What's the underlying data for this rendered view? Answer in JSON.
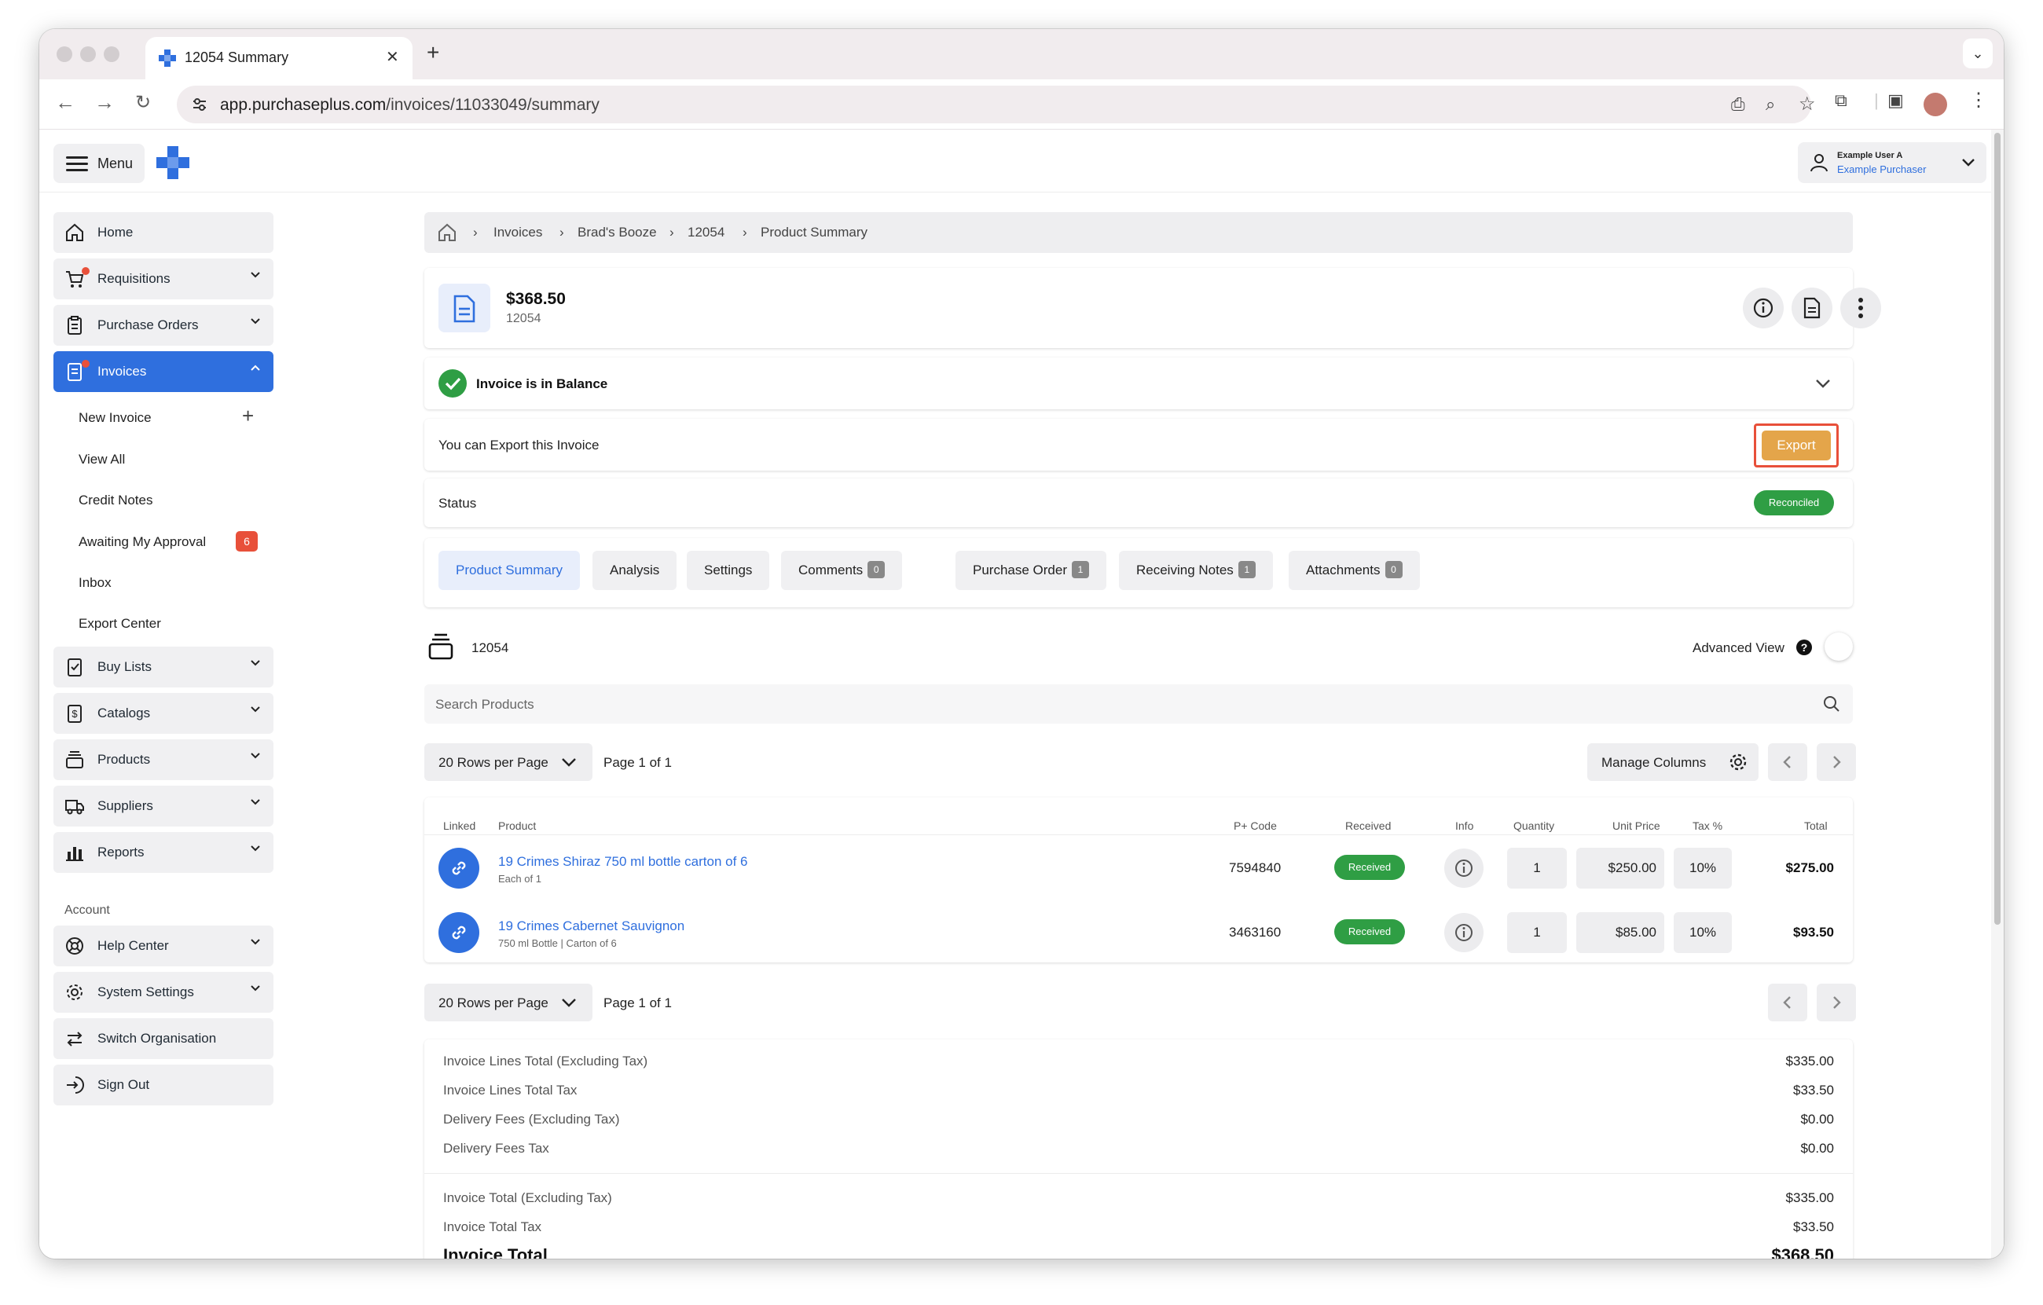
{
  "browser": {
    "tab_title": "12054 Summary",
    "url_domain": "app.purchaseplus.com",
    "url_path": "/invoices/11033049/summary"
  },
  "header": {
    "menu_label": "Menu",
    "user_name": "Example User A",
    "user_role": "Example Purchaser"
  },
  "sidebar": {
    "home": "Home",
    "requisitions": "Requisitions",
    "purchase_orders": "Purchase Orders",
    "invoices": "Invoices",
    "new_invoice": "New Invoice",
    "view_all": "View All",
    "credit_notes": "Credit Notes",
    "awaiting_my_approval": "Awaiting My Approval",
    "awaiting_count": "6",
    "inbox": "Inbox",
    "export_center": "Export Center",
    "buy_lists": "Buy Lists",
    "catalogs": "Catalogs",
    "products": "Products",
    "suppliers": "Suppliers",
    "reports": "Reports",
    "account_label": "Account",
    "help_center": "Help Center",
    "system_settings": "System Settings",
    "switch_organisation": "Switch Organisation",
    "sign_out": "Sign Out"
  },
  "breadcrumb": {
    "invoices": "Invoices",
    "supplier": "Brad's Booze",
    "invoice": "12054",
    "current": "Product Summary"
  },
  "invoice": {
    "amount": "$368.50",
    "number": "12054",
    "balance_text": "Invoice is in Balance",
    "export_text": "You can Export this Invoice",
    "export_button": "Export",
    "status_label": "Status",
    "status_value": "Reconciled"
  },
  "tabs": {
    "product_summary": "Product Summary",
    "analysis": "Analysis",
    "settings": "Settings",
    "comments": "Comments",
    "comments_count": "0",
    "purchase_order": "Purchase Order",
    "purchase_order_count": "1",
    "receiving_notes": "Receiving Notes",
    "receiving_notes_count": "1",
    "attachments": "Attachments",
    "attachments_count": "0"
  },
  "products_section": {
    "title": "12054",
    "advanced_view": "Advanced View",
    "search_placeholder": "Search Products",
    "rows_per_page": "20 Rows per Page",
    "page_info": "Page 1 of 1",
    "manage_columns": "Manage Columns"
  },
  "table": {
    "headers": {
      "linked": "Linked",
      "product": "Product",
      "code": "P+ Code",
      "received": "Received",
      "info": "Info",
      "quantity": "Quantity",
      "unit_price": "Unit Price",
      "tax": "Tax %",
      "total": "Total"
    },
    "rows": [
      {
        "name": "19 Crimes Shiraz 750 ml bottle carton of 6",
        "sub": "Each of 1",
        "code": "7594840",
        "received": "Received",
        "quantity": "1",
        "unit_price": "$250.00",
        "tax": "10%",
        "total": "$275.00"
      },
      {
        "name": "19 Crimes Cabernet Sauvignon",
        "sub": "750 ml Bottle | Carton of 6",
        "code": "3463160",
        "received": "Received",
        "quantity": "1",
        "unit_price": "$85.00",
        "tax": "10%",
        "total": "$93.50"
      }
    ]
  },
  "summary": {
    "lines_total_ex_label": "Invoice Lines Total (Excluding Tax)",
    "lines_total_ex": "$335.00",
    "lines_tax_label": "Invoice Lines Total Tax",
    "lines_tax": "$33.50",
    "delivery_ex_label": "Delivery Fees (Excluding Tax)",
    "delivery_ex": "$0.00",
    "delivery_tax_label": "Delivery Fees Tax",
    "delivery_tax": "$0.00",
    "invoice_total_ex_label": "Invoice Total (Excluding Tax)",
    "invoice_total_ex": "$335.00",
    "invoice_total_tax_label": "Invoice Total Tax",
    "invoice_total_tax": "$33.50",
    "invoice_total_label": "Invoice Total",
    "invoice_total": "$368.50"
  },
  "colors": {
    "accent": "#2f6fde",
    "export_button": "#e4a54a",
    "export_highlight": "#e8503a",
    "success": "#2f9e44"
  }
}
